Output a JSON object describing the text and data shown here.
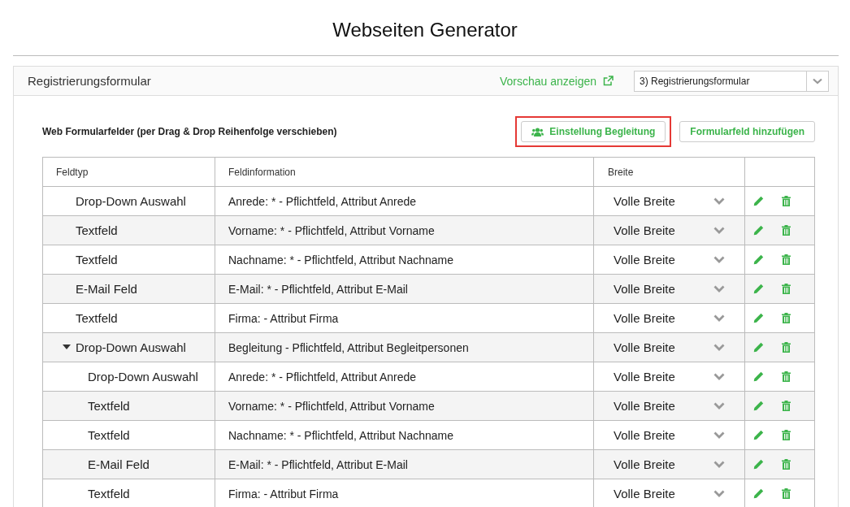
{
  "page_title": "Webseiten Generator",
  "panel": {
    "title": "Registrierungsformular",
    "preview_link": "Vorschau anzeigen",
    "form_select": {
      "value": "3) Registrierungsformular"
    }
  },
  "section": {
    "heading": "Web Formularfelder (per Drag & Drop Reihenfolge verschieben)",
    "buttons": [
      {
        "label": "Einstellung Begleitung",
        "kind": "icon",
        "highlighted": true
      },
      {
        "label": "Formularfeld hinzufügen",
        "kind": "plain",
        "highlighted": false
      }
    ]
  },
  "table": {
    "columns": [
      "Feldtyp",
      "Feldinformation",
      "Breite"
    ],
    "rows": [
      {
        "type": "Drop-Down Auswahl",
        "info": "Anrede: * - Pflichtfeld, Attribut Anrede",
        "width": "Volle Breite"
      },
      {
        "type": "Textfeld",
        "info": "Vorname: * - Pflichtfeld, Attribut Vorname",
        "width": "Volle Breite"
      },
      {
        "type": "Textfeld",
        "info": "Nachname: * - Pflichtfeld, Attribut Nachname",
        "width": "Volle Breite"
      },
      {
        "type": "E-Mail Feld",
        "info": "E-Mail: * - Pflichtfeld, Attribut E-Mail",
        "width": "Volle Breite"
      },
      {
        "type": "Textfeld",
        "info": "Firma: - Attribut Firma",
        "width": "Volle Breite"
      },
      {
        "type": "Drop-Down Auswahl",
        "info": "Begleitung - Pflichtfeld, Attribut Begleitpersonen",
        "width": "Volle Breite",
        "expanded": true,
        "children": [
          {
            "type": "Drop-Down Auswahl",
            "info": "Anrede: * - Pflichtfeld, Attribut Anrede",
            "width": "Volle Breite"
          },
          {
            "type": "Textfeld",
            "info": "Vorname: * - Pflichtfeld, Attribut Vorname",
            "width": "Volle Breite"
          },
          {
            "type": "Textfeld",
            "info": "Nachname: * - Pflichtfeld, Attribut Nachname",
            "width": "Volle Breite"
          },
          {
            "type": "E-Mail Feld",
            "info": "E-Mail: * - Pflichtfeld, Attribut E-Mail",
            "width": "Volle Breite"
          },
          {
            "type": "Textfeld",
            "info": "Firma: - Attribut Firma",
            "width": "Volle Breite"
          }
        ]
      }
    ]
  }
}
